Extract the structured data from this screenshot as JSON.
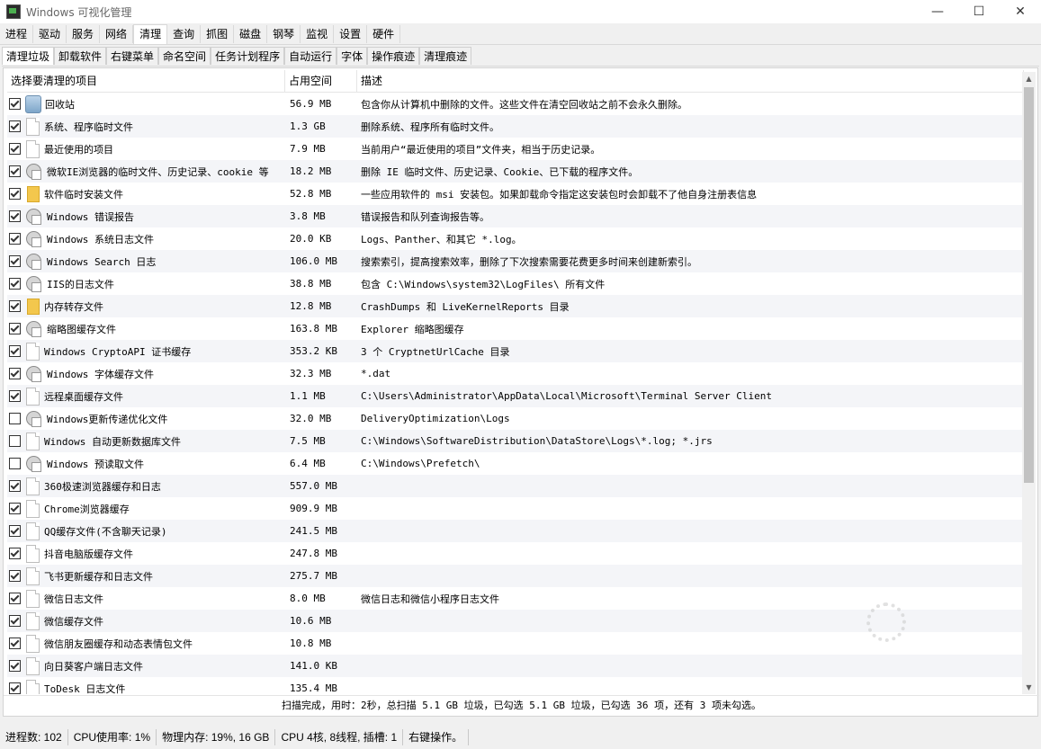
{
  "window": {
    "title": "Windows 可视化管理",
    "minimize": "—",
    "maximize": "☐",
    "close": "✕"
  },
  "main_tabs": [
    "进程",
    "驱动",
    "服务",
    "网络",
    "清理",
    "查询",
    "抓图",
    "磁盘",
    "钢琴",
    "监视",
    "设置",
    "硬件"
  ],
  "main_active": 4,
  "sub_tabs": [
    "清理垃圾",
    "卸载软件",
    "右键菜单",
    "命名空间",
    "任务计划程序",
    "自动运行",
    "字体",
    "操作痕迹",
    "清理痕迹"
  ],
  "sub_active": 0,
  "list": {
    "headers": [
      "选择要清理的项目",
      "占用空间",
      "描述"
    ],
    "rows": [
      {
        "checked": true,
        "icon": "recycle-bin-icon",
        "name": "回收站",
        "size": "56.9 MB",
        "desc": "包含你从计算机中删除的文件。这些文件在清空回收站之前不会永久删除。"
      },
      {
        "checked": true,
        "icon": "file-icon",
        "name": "系统、程序临时文件",
        "size": "1.3 GB",
        "desc": "删除系统、程序所有临时文件。"
      },
      {
        "checked": true,
        "icon": "file-icon",
        "name": "最近使用的项目",
        "size": "7.9 MB",
        "desc": "当前用户“最近使用的项目”文件夹，相当于历史记录。"
      },
      {
        "checked": true,
        "icon": "settings-icon",
        "name": "微软IE浏览器的临时文件、历史记录、cookie 等",
        "size": "18.2 MB",
        "desc": "删除 IE 临时文件、历史记录、Cookie、已下载的程序文件。"
      },
      {
        "checked": true,
        "icon": "folder-icon",
        "name": "软件临时安装文件",
        "size": "52.8 MB",
        "desc": "一些应用软件的 msi 安装包。如果卸载命令指定这安装包时会卸载不了他自身注册表信息"
      },
      {
        "checked": true,
        "icon": "settings-icon",
        "name": "Windows 错误报告",
        "size": "3.8 MB",
        "desc": "错误报告和队列查询报告等。"
      },
      {
        "checked": true,
        "icon": "settings-icon",
        "name": "Windows 系统日志文件",
        "size": "20.0 KB",
        "desc": "Logs、Panther、和其它 *.log。"
      },
      {
        "checked": true,
        "icon": "settings-icon",
        "name": "Windows Search 日志",
        "size": "106.0 MB",
        "desc": "搜索索引，提高搜索效率，删除了下次搜索需要花费更多时间来创建新索引。"
      },
      {
        "checked": true,
        "icon": "settings-icon",
        "name": "IIS的日志文件",
        "size": "38.8 MB",
        "desc": "包含 C:\\Windows\\system32\\LogFiles\\ 所有文件"
      },
      {
        "checked": true,
        "icon": "folder-icon",
        "name": "内存转存文件",
        "size": "12.8 MB",
        "desc": "CrashDumps 和 LiveKernelReports 目录"
      },
      {
        "checked": true,
        "icon": "settings-icon",
        "name": "缩略图缓存文件",
        "size": "163.8 MB",
        "desc": "Explorer 缩略图缓存"
      },
      {
        "checked": true,
        "icon": "file-icon",
        "name": "Windows CryptoAPI 证书缓存",
        "size": "353.2 KB",
        "desc": "3 个 CryptnetUrlCache 目录"
      },
      {
        "checked": true,
        "icon": "settings-icon",
        "name": "Windows 字体缓存文件",
        "size": "32.3 MB",
        "desc": "*.dat"
      },
      {
        "checked": true,
        "icon": "file-icon",
        "name": "远程桌面缓存文件",
        "size": "1.1 MB",
        "desc": "C:\\Users\\Administrator\\AppData\\Local\\Microsoft\\Terminal Server Client"
      },
      {
        "checked": false,
        "icon": "settings-icon",
        "name": "Windows更新传递优化文件",
        "size": "32.0 MB",
        "desc": "DeliveryOptimization\\Logs"
      },
      {
        "checked": false,
        "icon": "file-icon",
        "name": "Windows 自动更新数据库文件",
        "size": "7.5 MB",
        "desc": "C:\\Windows\\SoftwareDistribution\\DataStore\\Logs\\*.log; *.jrs"
      },
      {
        "checked": false,
        "icon": "settings-icon",
        "name": "Windows 预读取文件",
        "size": "6.4 MB",
        "desc": "C:\\Windows\\Prefetch\\"
      },
      {
        "checked": true,
        "icon": "file-icon",
        "name": "360极速浏览器缓存和日志",
        "size": "557.0 MB",
        "desc": ""
      },
      {
        "checked": true,
        "icon": "file-icon",
        "name": "Chrome浏览器缓存",
        "size": "909.9 MB",
        "desc": ""
      },
      {
        "checked": true,
        "icon": "file-icon",
        "name": "QQ缓存文件(不含聊天记录)",
        "size": "241.5 MB",
        "desc": ""
      },
      {
        "checked": true,
        "icon": "file-icon",
        "name": "抖音电脑版缓存文件",
        "size": "247.8 MB",
        "desc": ""
      },
      {
        "checked": true,
        "icon": "file-icon",
        "name": "飞书更新缓存和日志文件",
        "size": "275.7 MB",
        "desc": ""
      },
      {
        "checked": true,
        "icon": "file-icon",
        "name": "微信日志文件",
        "size": "8.0 MB",
        "desc": "微信日志和微信小程序日志文件"
      },
      {
        "checked": true,
        "icon": "file-icon",
        "name": "微信缓存文件",
        "size": "10.6 MB",
        "desc": ""
      },
      {
        "checked": true,
        "icon": "file-icon",
        "name": "微信朋友圈缓存和动态表情包文件",
        "size": "10.8 MB",
        "desc": ""
      },
      {
        "checked": true,
        "icon": "file-icon",
        "name": "向日葵客户端日志文件",
        "size": "141.0 KB",
        "desc": ""
      },
      {
        "checked": true,
        "icon": "file-icon",
        "name": "ToDesk 日志文件",
        "size": "135.4 MB",
        "desc": ""
      }
    ]
  },
  "scan_status": "扫描完成，用时：2秒，总扫描 5.1 GB 垃圾，已勾选 5.1 GB 垃圾，已勾选 36 项，还有 3 项未勾选。",
  "statusbar": [
    "进程数: 102",
    "CPU使用率: 1%",
    "物理内存: 19%, 16 GB",
    "CPU 4核, 8线程, 插槽: 1",
    "右键操作。"
  ]
}
